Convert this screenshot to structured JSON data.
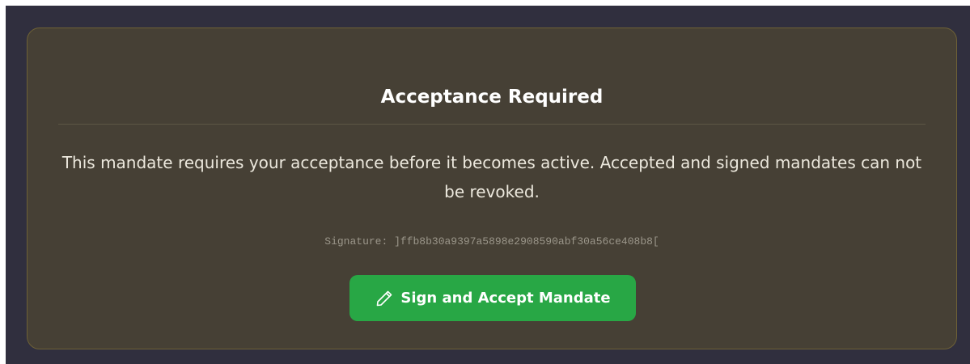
{
  "acceptance": {
    "title": "Acceptance Required",
    "message": "This mandate requires your acceptance before it becomes active. Accepted and signed mandates can not be revoked.",
    "signature": "Signature: ]ffb8b30a9397a5898e2908590abf30a56ce408b8[",
    "sign_button_label": "Sign and Accept Mandate",
    "sign_button_icon": "pencil-icon"
  },
  "colors": {
    "background": "#302f3e",
    "card": "#464035",
    "card_border": "#6e6136",
    "accept_button": "#28a745"
  }
}
